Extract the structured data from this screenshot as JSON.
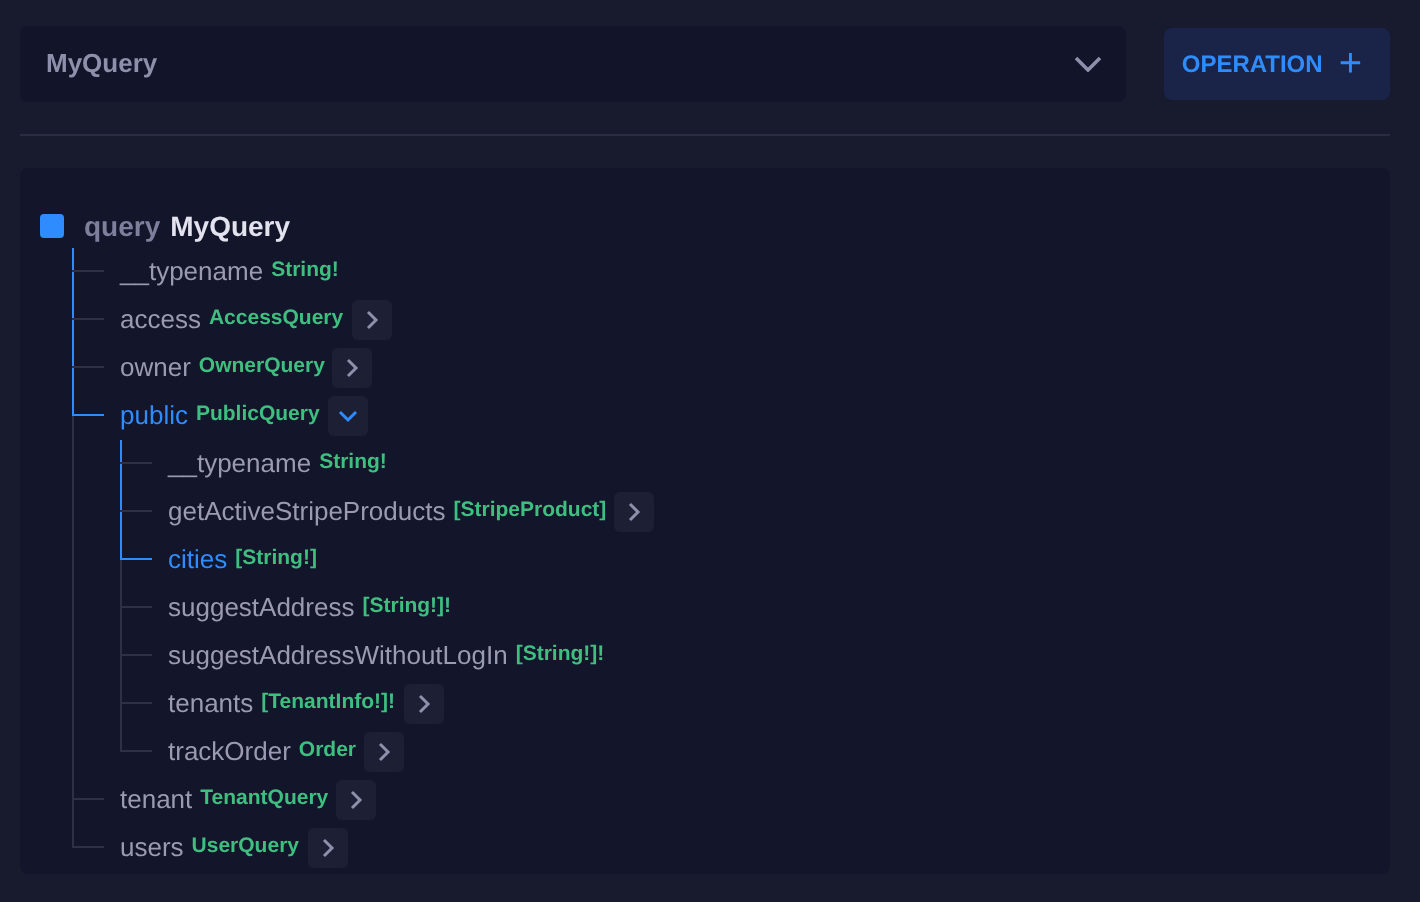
{
  "operation_select": {
    "value": "MyQuery"
  },
  "add_operation_button": {
    "label": "OPERATION",
    "icon": "+"
  },
  "tree": {
    "keyword": "query",
    "name": "MyQuery",
    "selected": true,
    "children": [
      {
        "name": "__typename",
        "type": "String!",
        "kind": "leaf",
        "selected": false
      },
      {
        "name": "access",
        "type": "AccessQuery",
        "kind": "object",
        "expanded": false,
        "selected": false
      },
      {
        "name": "owner",
        "type": "OwnerQuery",
        "kind": "object",
        "expanded": false,
        "selected": false
      },
      {
        "name": "public",
        "type": "PublicQuery",
        "kind": "object",
        "expanded": true,
        "selected": true,
        "children": [
          {
            "name": "__typename",
            "type": "String!",
            "kind": "leaf",
            "selected": false
          },
          {
            "name": "getActiveStripeProducts",
            "type": "[StripeProduct]",
            "kind": "object",
            "expanded": false,
            "selected": false
          },
          {
            "name": "cities",
            "type": "[String!]",
            "kind": "leaf",
            "selected": true
          },
          {
            "name": "suggestAddress",
            "type": "[String!]!",
            "kind": "leaf",
            "selected": false
          },
          {
            "name": "suggestAddressWithoutLogIn",
            "type": "[String!]!",
            "kind": "leaf",
            "selected": false
          },
          {
            "name": "tenants",
            "type": "[TenantInfo!]!",
            "kind": "object",
            "expanded": false,
            "selected": false
          },
          {
            "name": "trackOrder",
            "type": "Order",
            "kind": "object",
            "expanded": false,
            "selected": false
          }
        ]
      },
      {
        "name": "tenant",
        "type": "TenantQuery",
        "kind": "object",
        "expanded": false,
        "selected": false
      },
      {
        "name": "users",
        "type": "UserQuery",
        "kind": "object",
        "expanded": false,
        "selected": false
      }
    ]
  }
}
